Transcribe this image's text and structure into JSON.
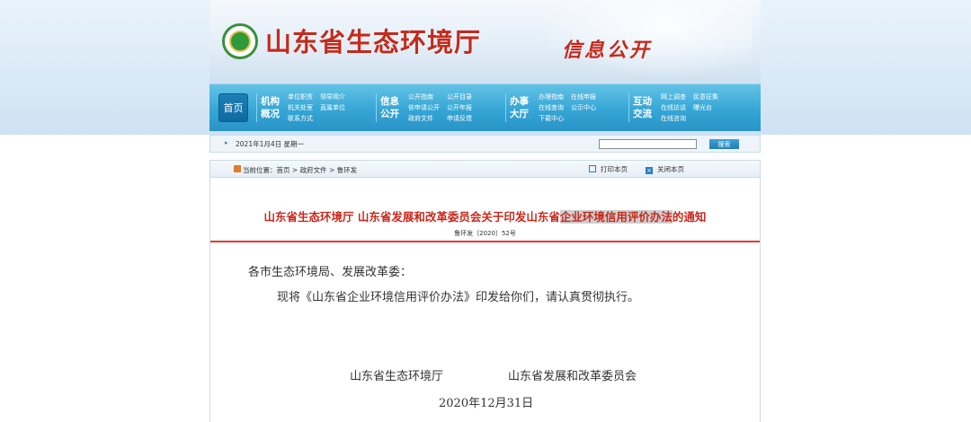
{
  "header": {
    "site_title": "山东省生态环境厅",
    "section_title": "信息公开"
  },
  "nav": {
    "home_label": "首页",
    "sections": [
      {
        "label_line1": "机构",
        "label_line2": "概况",
        "links": [
          "单位职责",
          "领导简介",
          "机关处室",
          "直属单位",
          "联系方式"
        ]
      },
      {
        "label_line1": "信息",
        "label_line2": "公开",
        "links": [
          "公开指南",
          "公开目录",
          "依申请公开",
          "公开年报",
          "政府文件",
          "申请反馈"
        ]
      },
      {
        "label_line1": "办事",
        "label_line2": "大厅",
        "links": [
          "办理指南",
          "在线申报",
          "在线查询",
          "公示中心",
          "下载中心"
        ]
      },
      {
        "label_line1": "互动",
        "label_line2": "交流",
        "links": [
          "网上调查",
          "民意征集",
          "在线访谈",
          "曝光台",
          "在线咨询"
        ]
      }
    ]
  },
  "datebar": {
    "arrow": "▸",
    "date": "2021年1月4日 星期一",
    "search_placeholder": "",
    "search_button": "搜索"
  },
  "breadcrumb": {
    "prefix": "当前位置：",
    "items": [
      "首页",
      "政府文件",
      "鲁环发"
    ],
    "separator": " > ",
    "print_label": "打印本页",
    "close_label": "关闭本页"
  },
  "document": {
    "title_part1": "山东省生态环境厅 山东省发展和改革委员会关于印发山东省",
    "title_highlight": "企业环境信用评价办法",
    "title_part2": "的通知",
    "number": "鲁环发〔2020〕52号",
    "addressee": "各市生态环境局、发展改革委：",
    "body": "现将《山东省企业环境信用评价办法》印发给你们，请认真贯彻执行。",
    "signer1": "山东省生态环境厅",
    "signer2": "山东省发展和改革委员会",
    "date": "2020年12月31日"
  },
  "colors": {
    "title_red": "#c8281c",
    "nav_blue": "#35a6d6",
    "divider_red": "#e03a2a"
  },
  "icons": [
    "emblem-logo",
    "print-icon",
    "close-icon",
    "home-icon"
  ]
}
